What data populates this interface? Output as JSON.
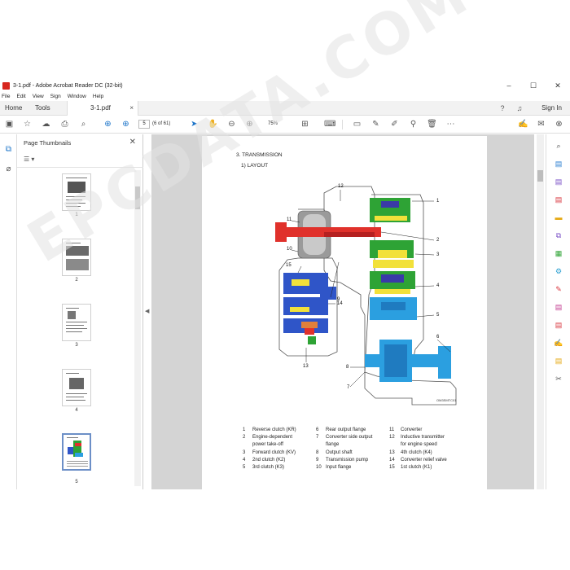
{
  "window": {
    "title": "3-1.pdf - Adobe Acrobat Reader DC (32-bit)",
    "minimize": "‒",
    "maximize": "☐",
    "close": "✕"
  },
  "menu": [
    "File",
    "Edit",
    "View",
    "Sign",
    "Window",
    "Help"
  ],
  "tabs": {
    "home": "Home",
    "tools": "Tools",
    "doc": "3-1.pdf",
    "doc_close": "×",
    "sign_in": "Sign In"
  },
  "toolbar": {
    "page_value": "5",
    "page_count": "(6 of 61)",
    "zoom_value": "75%"
  },
  "panel": {
    "title": "Page Thumbnails",
    "close": "✕",
    "options": "☰ ▾",
    "thumbs": [
      "1",
      "2",
      "3",
      "4",
      "5"
    ]
  },
  "doc": {
    "section_title": "3. TRANSMISSION",
    "sub_title": "1) LAYOUT",
    "figure_code": "OM3SMTC01",
    "callouts": [
      "1",
      "2",
      "3",
      "4",
      "5",
      "6",
      "7",
      "8",
      "9",
      "10",
      "11",
      "12",
      "13",
      "14",
      "15"
    ],
    "legend_col1": [
      {
        "num": "1",
        "text": "Reverse clutch (KR)"
      },
      {
        "num": "2",
        "text": "Engine-dependent"
      },
      {
        "num": "",
        "text": "power take-off"
      },
      {
        "num": "3",
        "text": "Forward clutch (KV)"
      },
      {
        "num": "4",
        "text": "2nd clutch (K2)"
      },
      {
        "num": "5",
        "text": "3rd clutch (K3)"
      }
    ],
    "legend_col2": [
      {
        "num": "6",
        "text": "Rear output flange"
      },
      {
        "num": "7",
        "text": "Converter side output"
      },
      {
        "num": "",
        "text": "flange"
      },
      {
        "num": "8",
        "text": "Output shaft"
      },
      {
        "num": "9",
        "text": "Transmission pump"
      },
      {
        "num": "10",
        "text": "Input flange"
      }
    ],
    "legend_col3": [
      {
        "num": "11",
        "text": "Converter"
      },
      {
        "num": "12",
        "text": "Inductive transmitter"
      },
      {
        "num": "",
        "text": "for engine speed"
      },
      {
        "num": "13",
        "text": "4th clutch (K4)"
      },
      {
        "num": "14",
        "text": "Converter relief valve"
      },
      {
        "num": "15",
        "text": "1st clutch (K1)"
      }
    ],
    "watermark": "EPCDATA.COM"
  },
  "colors": {
    "accent": "#1a73c9",
    "clutch_red": "#e0312b",
    "clutch_green": "#2ea335",
    "clutch_yellow": "#f2e13a",
    "clutch_blue": "#2f55c8",
    "clutch_cyan": "#2b9fe0",
    "housing_gray": "#8a8a8a"
  }
}
